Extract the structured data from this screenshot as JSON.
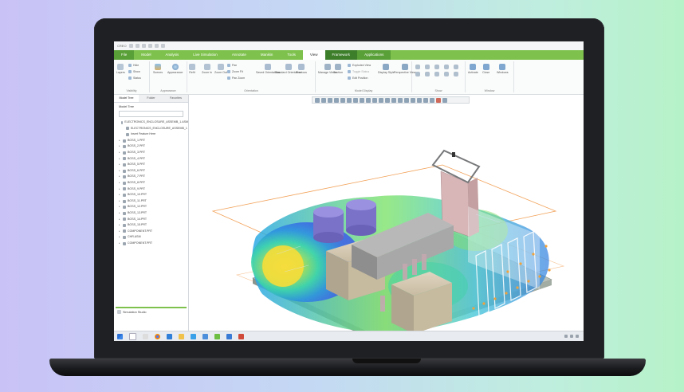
{
  "ui": {
    "title": "CREO",
    "tabs": [
      "File",
      "Model",
      "Analysis",
      "Live Simulation",
      "Annotate",
      "Manikin",
      "Tools",
      "View",
      "Framework",
      "Applications"
    ],
    "active_tab": "View",
    "ribbon_groups": [
      {
        "label": "Visibility",
        "buttons": [
          "Layers"
        ],
        "small": [
          "Hide",
          "Show",
          "Status"
        ]
      },
      {
        "label": "Appearance",
        "buttons": [
          "Scenes",
          "Appearance"
        ],
        "small": []
      },
      {
        "label": "Orientation",
        "buttons": [
          "Refit",
          "Zoom In",
          "Zoom Out",
          "Saved Orientations",
          "Standard Orientation",
          "Previous"
        ],
        "small": [
          "Pan",
          "Zoom Fit",
          "Pan Zoom"
        ]
      },
      {
        "label": "Model Display",
        "buttons": [
          "Manage Views",
          "Section",
          "Display Style",
          "Perspective View"
        ],
        "small": [
          "Exploded View",
          "Toggle Status",
          "Edit Position"
        ]
      },
      {
        "label": "Show",
        "buttons": [],
        "small": []
      },
      {
        "label": "Window",
        "buttons": [
          "Activate",
          "Close",
          "Windows"
        ],
        "small": []
      }
    ],
    "sidebar": {
      "tabs": [
        "Model Tree",
        "Folder",
        "Favorites"
      ],
      "header": "Model Tree",
      "items": [
        "ELECTRONICS_ENCLOSURE_ASSEMB_1.ASM",
        "ELECTRONICS_ENCLOSURE_ASSEMB_1",
        "Insert Feature Here",
        "BOSS_1.PRT",
        "BOSS_2.PRT",
        "BOSS_3.PRT",
        "BOSS_4.PRT",
        "BOSS_5.PRT",
        "BOSS_6.PRT",
        "BOSS_7.PRT",
        "BOSS_8.PRT",
        "BOSS_9.PRT",
        "BOSS_10.PRT",
        "BOSS_11.PRT",
        "BOSS_12.PRT",
        "BOSS_13.PRT",
        "BOSS_14.PRT",
        "BOSS_15.PRT",
        "COMPONENT.PRT",
        "CHR.ASM",
        "COMPONENT.PRT"
      ],
      "footer": "Simulation Studio"
    },
    "colors": {
      "accent": "#7ec24d",
      "accent_dark": "#3d7e2b",
      "bezel": "#1f2024"
    },
    "icons": [
      "search-icon",
      "file-explorer-icon",
      "chrome-icon",
      "windows-start-icon"
    ]
  }
}
